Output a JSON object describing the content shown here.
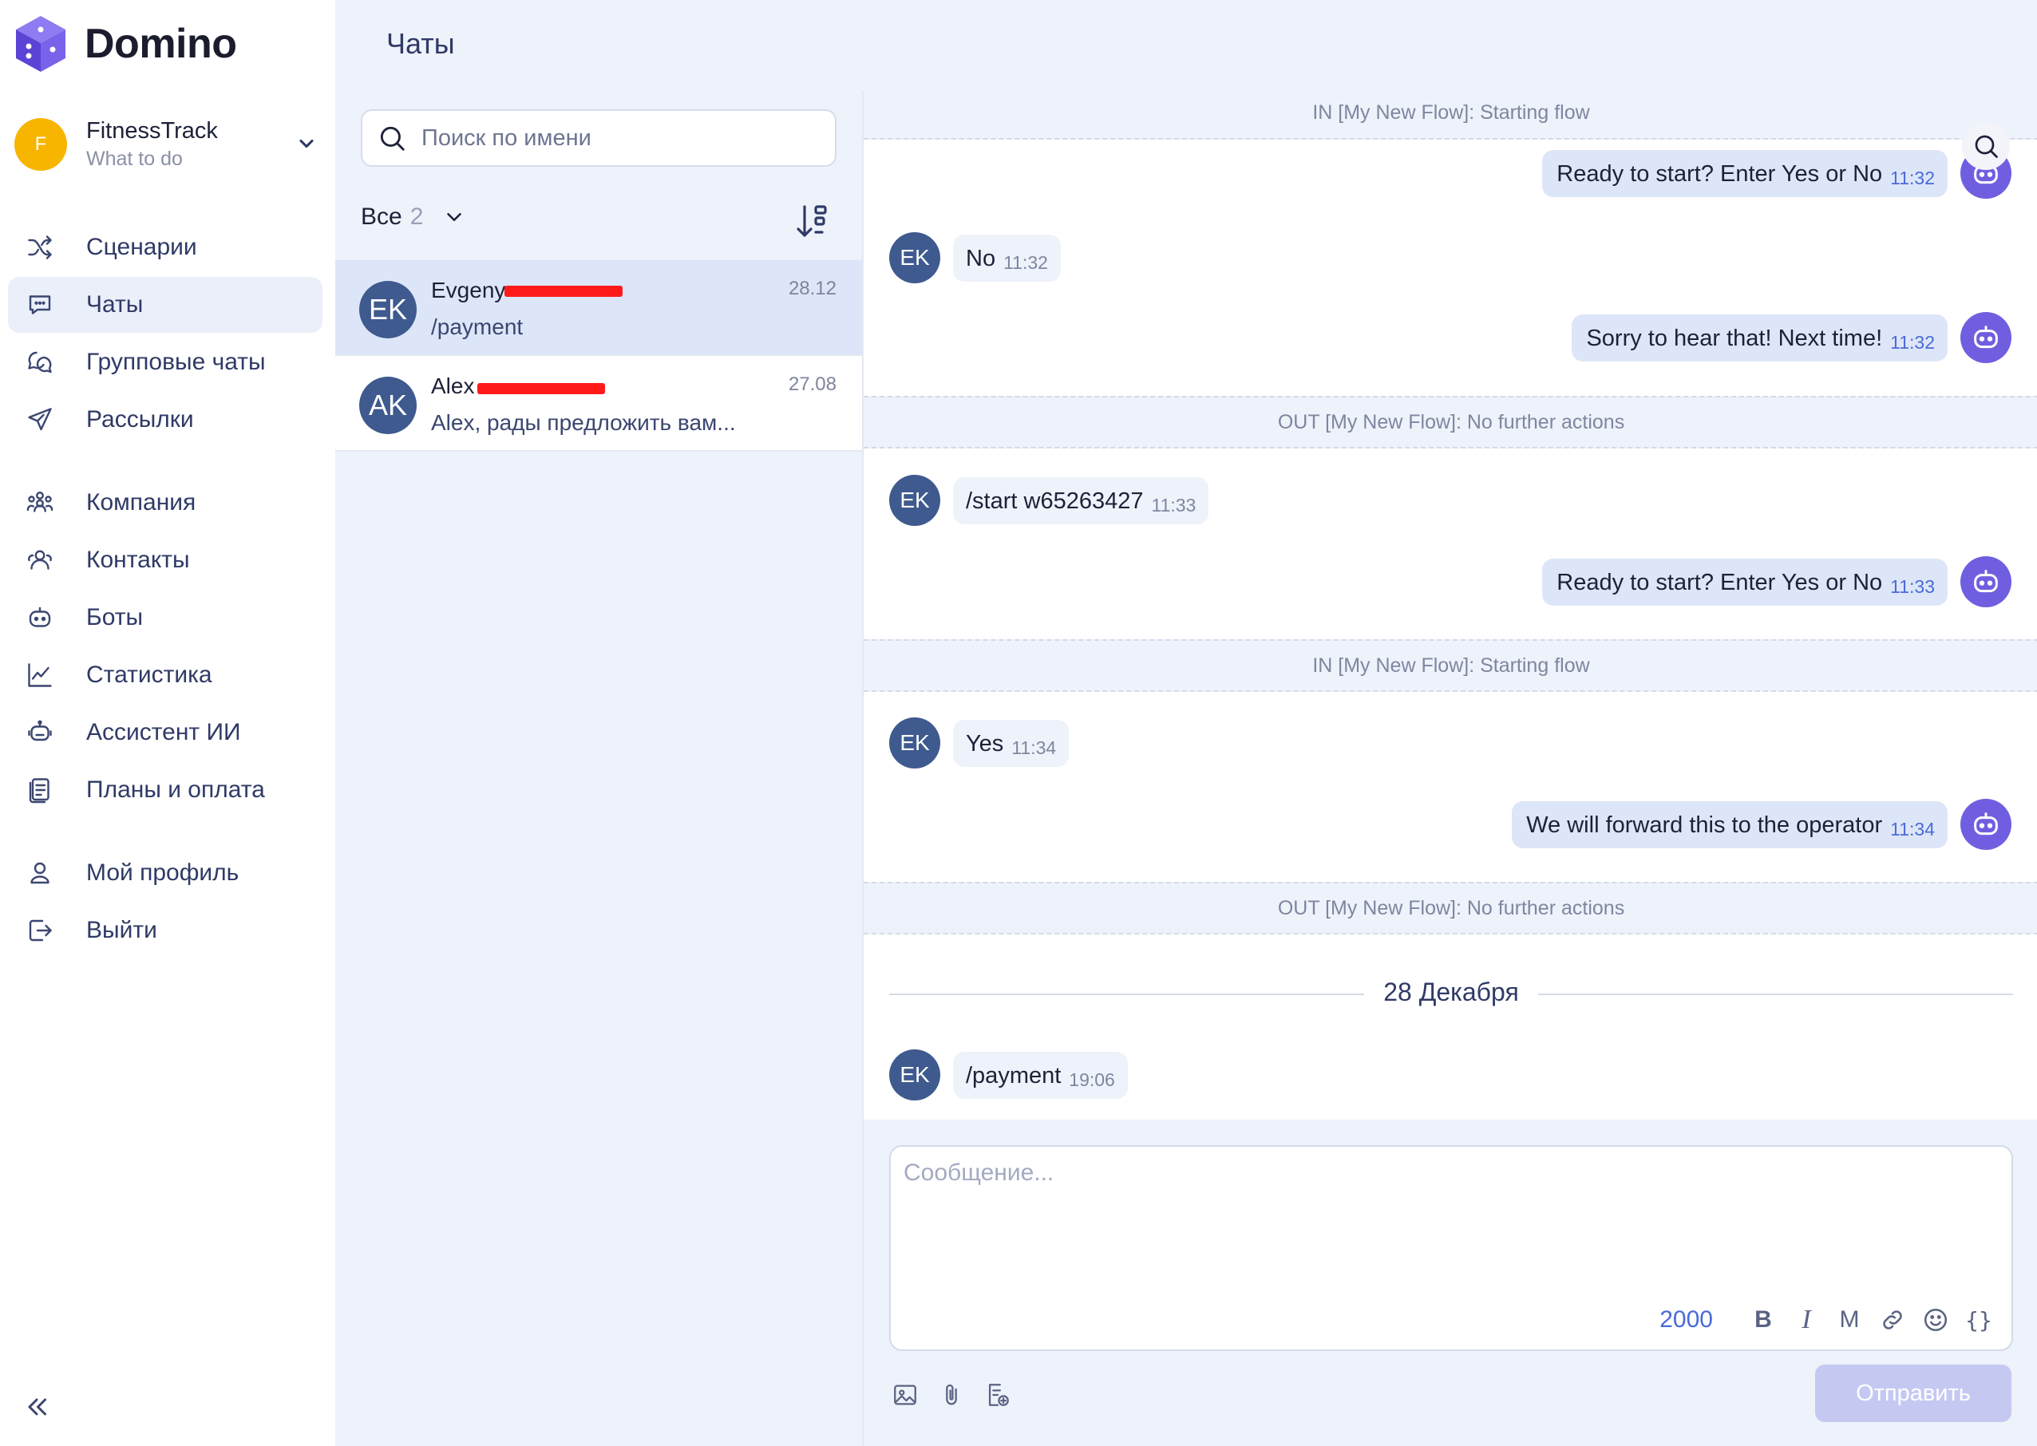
{
  "app": {
    "logo_text": "Domino",
    "colors": {
      "accent": "#6f5fe0",
      "primary_text": "#2f3a66",
      "redaction": "#ff1a1a",
      "workspace_avatar": "#f7b500"
    }
  },
  "workspace": {
    "avatar_letter": "F",
    "name": "FitnessTrack",
    "subtitle": "What to do"
  },
  "sidebar": {
    "items": [
      {
        "label": "Сценарии",
        "icon": "shuffle-icon"
      },
      {
        "label": "Чаты",
        "icon": "chat-icon",
        "active": true
      },
      {
        "label": "Групповые чаты",
        "icon": "group-chat-icon"
      },
      {
        "label": "Рассылки",
        "icon": "send-icon"
      },
      {
        "label": "Компания",
        "icon": "company-icon"
      },
      {
        "label": "Контакты",
        "icon": "contacts-icon"
      },
      {
        "label": "Боты",
        "icon": "bot-icon"
      },
      {
        "label": "Статистика",
        "icon": "chart-icon"
      },
      {
        "label": "Ассистент ИИ",
        "icon": "ai-assistant-icon"
      },
      {
        "label": "Планы и оплата",
        "icon": "billing-icon"
      },
      {
        "label": "Мой профиль",
        "icon": "user-icon"
      },
      {
        "label": "Выйти",
        "icon": "logout-icon"
      }
    ]
  },
  "header": {
    "title": "Чаты"
  },
  "chatlist": {
    "search_placeholder": "Поиск по имени",
    "filter_label": "Все",
    "filter_count": "2",
    "chats": [
      {
        "initials": "EK",
        "name": "Evgeny",
        "date": "28.12",
        "preview": "/payment",
        "selected": true
      },
      {
        "initials": "AK",
        "name": "Alex",
        "date": "27.08",
        "preview": "Alex, рады предложить вам..."
      }
    ]
  },
  "conversation": {
    "user_initials": "EK",
    "events": [
      {
        "type": "system",
        "text": "IN [My New Flow]: Starting flow"
      },
      {
        "type": "out",
        "text": "Ready to start? Enter Yes or No",
        "time": "11:32"
      },
      {
        "type": "in",
        "text": "No",
        "time": "11:32"
      },
      {
        "type": "out",
        "text": "Sorry to hear that! Next time!",
        "time": "11:32"
      },
      {
        "type": "system",
        "text": "OUT [My New Flow]: No further actions"
      },
      {
        "type": "in",
        "text": "/start w65263427",
        "time": "11:33"
      },
      {
        "type": "out",
        "text": "Ready to start? Enter Yes or No",
        "time": "11:33"
      },
      {
        "type": "system",
        "text": "IN [My New Flow]: Starting flow"
      },
      {
        "type": "in",
        "text": "Yes",
        "time": "11:34"
      },
      {
        "type": "out",
        "text": "We will forward this to the operator",
        "time": "11:34"
      },
      {
        "type": "system",
        "text": "OUT [My New Flow]: No further actions"
      }
    ],
    "day_separator": "28 Декабря",
    "last_message": {
      "text": "/payment",
      "time": "19:06"
    }
  },
  "composer": {
    "placeholder": "Сообщение...",
    "char_count": "2000",
    "bold_label": "B",
    "italic_label": "I",
    "mono_label": "M",
    "variables_label": "{}",
    "send_label": "Отправить"
  }
}
